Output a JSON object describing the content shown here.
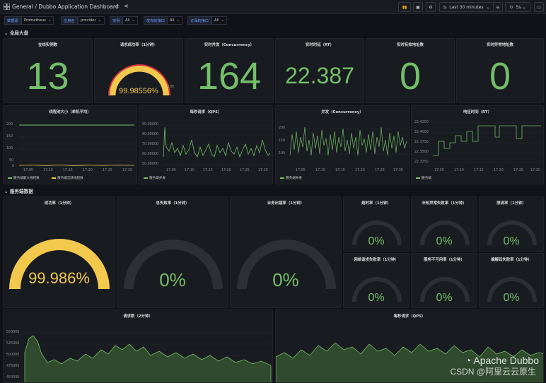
{
  "topbar": {
    "title": "General / Dubbo Application Dashboard",
    "time_range": "Last 30 minutes",
    "refresh": "5s"
  },
  "filters": [
    {
      "label": "数据源",
      "value": "Prometheus"
    },
    {
      "label": "应用名",
      "value": "provider"
    },
    {
      "label": "实例",
      "value": "All"
    },
    {
      "label": "发布的接口",
      "value": "All"
    },
    {
      "label": "订阅的接口",
      "value": "All"
    }
  ],
  "rows": {
    "overview": "全局大盘",
    "provider": "服务端数据"
  },
  "stats": {
    "instances": {
      "title": "在线实例数",
      "value": "13"
    },
    "success_rate": {
      "title": "请求成功率（1分钟）",
      "value": "99.98556%",
      "fraction": 0.9998556,
      "min": "0",
      "max": "100"
    },
    "concurrency": {
      "title": "实时并发（Concurrency）",
      "value": "164"
    },
    "rt": {
      "title": "实时时延（RT）",
      "value": "22.387"
    },
    "valid_addr": {
      "title": "实时有效地址数",
      "value": "0"
    },
    "invalid_addr": {
      "title": "实时异常地址数",
      "value": "0"
    }
  },
  "timeseries": {
    "threadpool": {
      "title": "线程池大小（单机平均）",
      "yticks": [
        "200",
        "150",
        "100",
        "50",
        "0"
      ],
      "xticks": [
        "17:05",
        "17:10",
        "17:15",
        "17:20",
        "17:25",
        "17:30"
      ],
      "legend": [
        "服务端最大线程数",
        "服务端活跃线程数"
      ]
    },
    "qps": {
      "title": "每秒请求（QPS）",
      "yticks": [
        "90.00000",
        "80.00000",
        "70.00000",
        "60.00000",
        "50.00000"
      ],
      "xticks": [
        "17:05",
        "17:10",
        "17:15",
        "17:20",
        "17:25",
        "17:30"
      ],
      "legend": [
        "服务端并发"
      ]
    },
    "concurrency": {
      "title": "并发（Concurrency）",
      "yticks": [
        "200",
        "150",
        "100"
      ],
      "xticks": [
        "17:05",
        "17:10",
        "17:15",
        "17:20",
        "17:25",
        "17:30"
      ],
      "legend": [
        "服务端并发"
      ]
    },
    "rt": {
      "title": "响应时间（RT）",
      "yticks": [
        "22.4250",
        "22.4000",
        "22.3750",
        "22.3500",
        "22.3250"
      ],
      "xticks": [
        "17:05",
        "17:10",
        "17:15",
        "17:20",
        "17:25",
        "17:30"
      ],
      "legend": [
        "服务端"
      ]
    }
  },
  "provider": {
    "success": {
      "title": "成功率（1分钟）",
      "value": "99.986%",
      "fraction": 0.99986
    },
    "total_fail": {
      "title": "总失败率（1分钟）",
      "value": "0%"
    },
    "biz_error": {
      "title": "业务出错率（1分钟）",
      "value": "0%"
    },
    "timeout": {
      "title": "超时率（1分钟）",
      "value": "0%"
    },
    "unknown_fail": {
      "title": "未知异常失败率（1分钟）",
      "value": "0%"
    },
    "limit": {
      "title": "限流率（1分钟）",
      "value": "0%"
    },
    "network_fail": {
      "title": "网络请求失败率（1分钟）",
      "value": "0%"
    },
    "unavailable": {
      "title": "服务不可用率（1分钟）",
      "value": "0%"
    },
    "codec_fail": {
      "title": "编解码失败率（1分钟）",
      "value": "0%"
    }
  },
  "bottom": {
    "requests": {
      "title": "请求数（2分钟）",
      "yticks": [
        "550000",
        "525000",
        "500000",
        "475000",
        "450000"
      ]
    },
    "qps": {
      "title": "每秒请求（QPS）"
    }
  },
  "watermark": {
    "line1": "Apache Dubbo",
    "line2": "CSDN @阿里云云原生"
  },
  "colors": {
    "green": "#73bf69",
    "yellow": "#f2c94c",
    "red": "#e02f44",
    "blue": "#6e9fff"
  }
}
